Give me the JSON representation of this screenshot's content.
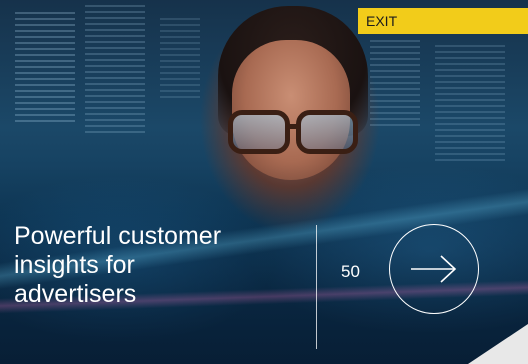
{
  "header": {
    "exit_label": "EXIT"
  },
  "main": {
    "title": "Powerful customer\ninsights for\nadvertisers",
    "page_number": "50"
  },
  "icons": {
    "next": "arrow-right-icon"
  },
  "colors": {
    "exit_background": "#f2cc1a",
    "text": "#ffffff"
  }
}
